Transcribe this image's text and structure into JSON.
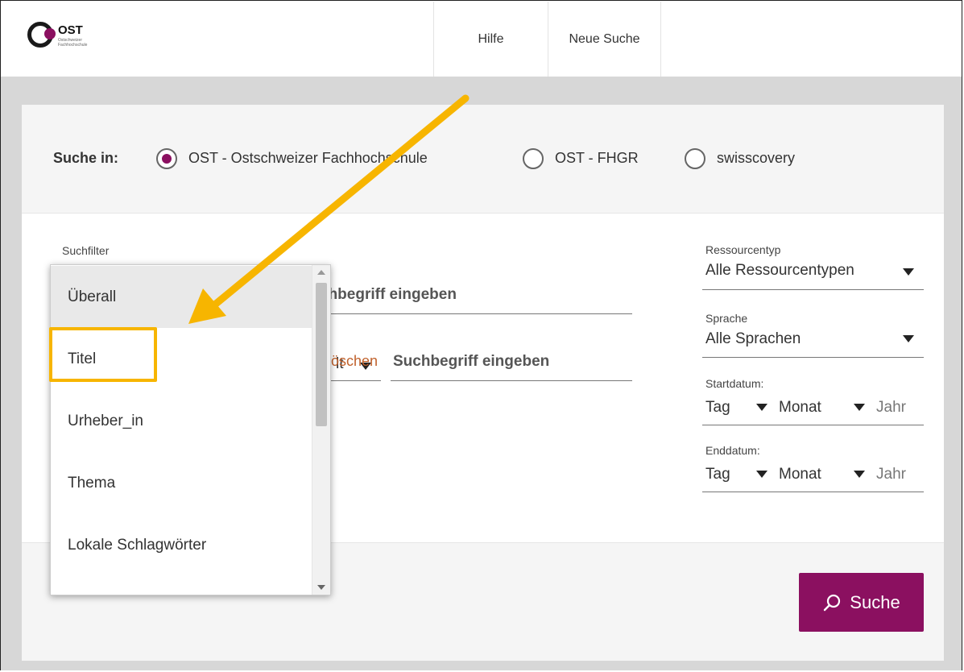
{
  "header": {
    "logo_text": "OST",
    "logo_sub": "Ostschweizer Fachhochschule",
    "nav": [
      {
        "label": "Hilfe"
      },
      {
        "label": "Neue Suche"
      }
    ]
  },
  "scope": {
    "label": "Suche in:",
    "options": [
      {
        "label": "OST - Ostschweizer Fachhochschule",
        "selected": true
      },
      {
        "label": "OST - FHGR",
        "selected": false
      },
      {
        "label": "swisscovery",
        "selected": false
      }
    ]
  },
  "filters": {
    "label": "Suchfilter",
    "row1_placeholder": "Suchbegriff eingeben",
    "row1_visible_placeholder": "chbegriff eingeben",
    "row2_operator_partial": "lt",
    "row2_placeholder": "Suchbegriff eingeben",
    "delete_label": "Löschen"
  },
  "dropdown": {
    "items": [
      {
        "label": "Überall",
        "selected": true
      },
      {
        "label": "Titel",
        "selected": false
      },
      {
        "label": "Urheber_in",
        "selected": false
      },
      {
        "label": "Thema",
        "selected": false
      },
      {
        "label": "Lokale Schlagwörter",
        "selected": false
      }
    ]
  },
  "sidebar": {
    "resource": {
      "label": "Ressourcentyp",
      "value": "Alle Ressourcentypen"
    },
    "language": {
      "label": "Sprache",
      "value": "Alle Sprachen"
    },
    "start": {
      "label": "Startdatum:",
      "day": "Tag",
      "month": "Monat",
      "year": "Jahr"
    },
    "end": {
      "label": "Enddatum:",
      "day": "Tag",
      "month": "Monat",
      "year": "Jahr"
    }
  },
  "search_button": {
    "label": "Suche"
  },
  "colors": {
    "brand": "#8b1060",
    "highlight": "#f7b500",
    "link": "#c0612b"
  }
}
